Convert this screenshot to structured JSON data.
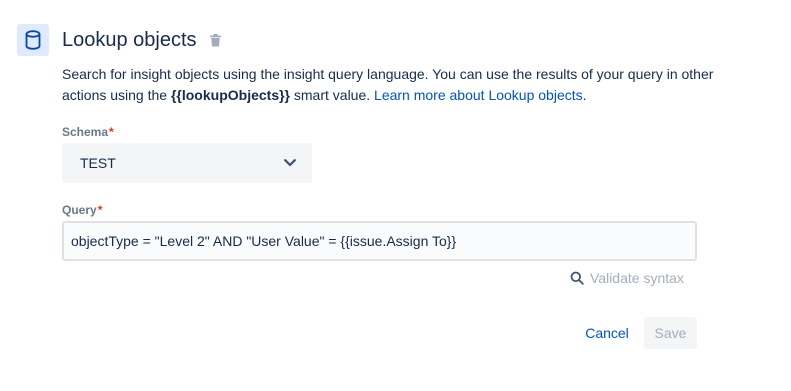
{
  "header": {
    "icon": "database-icon",
    "title": "Lookup objects",
    "delete_icon": "trash-icon"
  },
  "description": {
    "text_before": "Search for insight objects using the insight query language. You can use the results of your query in other actions using the ",
    "smart_value": "{{lookupObjects}}",
    "text_after": " smart value. ",
    "link_text": "Learn more about Lookup objects",
    "link_suffix": "."
  },
  "schema": {
    "label": "Schema",
    "required_marker": "*",
    "selected_value": "TEST"
  },
  "query": {
    "label": "Query",
    "required_marker": "*",
    "value": "objectType = \"Level 2\" AND \"User Value\" = {{issue.Assign To}}"
  },
  "validate": {
    "label": "Validate syntax",
    "icon": "search-icon"
  },
  "actions": {
    "cancel_label": "Cancel",
    "save_label": "Save"
  },
  "colors": {
    "link": "#0052cc",
    "required": "#de350b",
    "icon_bg": "#deebff",
    "disabled_text": "#a5adba"
  }
}
